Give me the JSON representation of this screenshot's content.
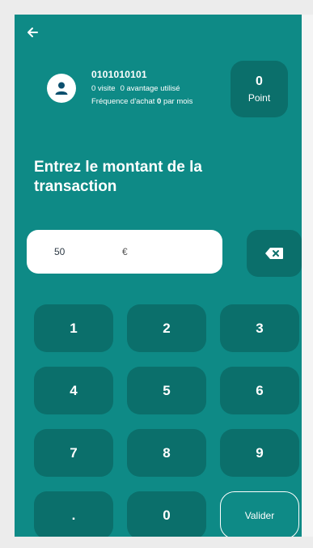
{
  "header": {
    "back_icon": "arrow-left-icon"
  },
  "customer": {
    "avatar_icon": "user-icon",
    "phone": "0101010101",
    "visits": "0 visite",
    "advantages": "0 avantage utilisé",
    "frequency_prefix": "Fréquence d'achat",
    "frequency_value": "0",
    "frequency_suffix": "par mois"
  },
  "points": {
    "value": "0",
    "label": "Point"
  },
  "title": "Entrez le montant de la transaction",
  "amount": {
    "value": "50",
    "currency": "€"
  },
  "backspace_icon": "backspace-icon",
  "keypad": {
    "keys": [
      "1",
      "2",
      "3",
      "4",
      "5",
      "6",
      "7",
      "8",
      "9",
      ".",
      "0"
    ],
    "validate_label": "Valider"
  },
  "colors": {
    "background": "#0e8a86",
    "button": "#0b6f6b",
    "text": "#ffffff"
  }
}
